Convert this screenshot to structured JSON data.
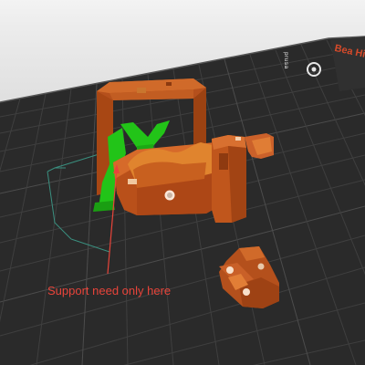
{
  "viewport": {
    "annotation_text": "Support need only here",
    "bed_brand_text": "Bea Hi",
    "bed_logo_text": "prusa",
    "colors": {
      "bed": "#2a2a2a",
      "grid_minor": "#3e3e3e",
      "grid_major": "#4b4b4b",
      "part_orange": "#b94e18",
      "part_orange_light": "#d66a2a",
      "support_green": "#22c418",
      "annotation_red": "#e8443a",
      "bbox_teal": "#3a8f7f"
    },
    "icons": [
      "prusa-logo-icon"
    ]
  }
}
